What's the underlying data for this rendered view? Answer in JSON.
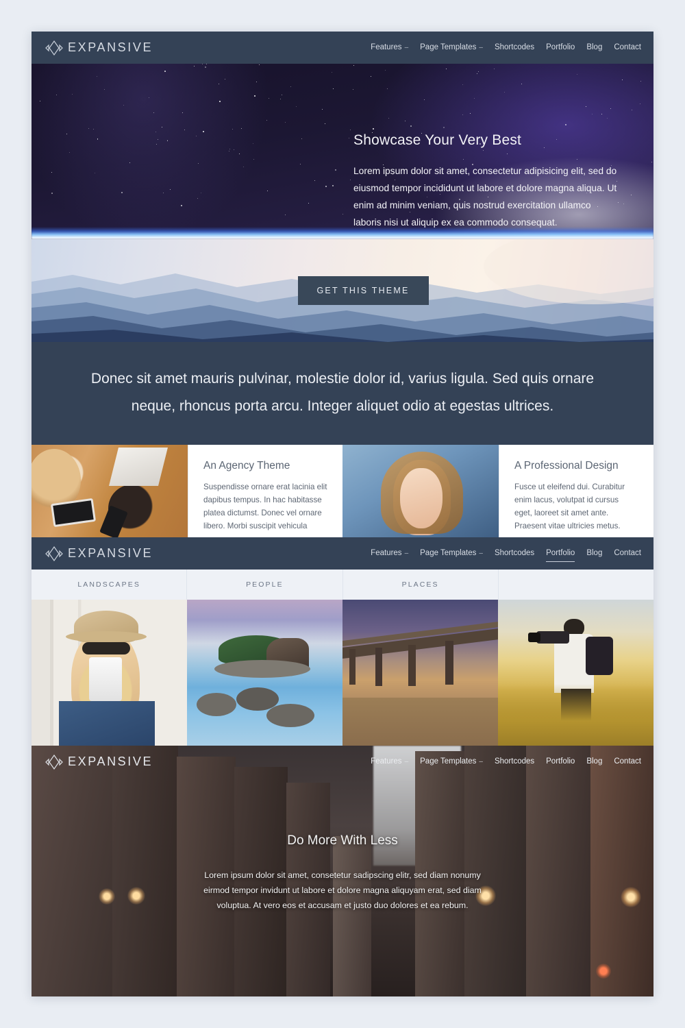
{
  "brand": {
    "name": "EXPANSIVE",
    "logo_icon": "diamond-arrows-icon"
  },
  "nav": {
    "items": [
      {
        "label": "Features",
        "caret": "–",
        "has_dropdown": true,
        "active": false
      },
      {
        "label": "Page Templates",
        "caret": "–",
        "has_dropdown": true,
        "active": false
      },
      {
        "label": "Shortcodes",
        "caret": "",
        "has_dropdown": false,
        "active": false
      },
      {
        "label": "Portfolio",
        "caret": "",
        "has_dropdown": false,
        "active": false
      },
      {
        "label": "Blog",
        "caret": "",
        "has_dropdown": false,
        "active": false
      },
      {
        "label": "Contact",
        "caret": "",
        "has_dropdown": false,
        "active": false
      }
    ],
    "portfolio_active_index": 3
  },
  "hero": {
    "title": "Showcase Your Very Best",
    "paragraph": "Lorem ipsum dolor sit amet, consectetur adipisicing elit, sed do eiusmod tempor incididunt ut labore et dolore magna aliqua. Ut enim ad minim veniam, quis nostrud exercitation ullamco laboris nisi ut aliquip ex ea commodo consequat.",
    "cta_label": "GET THIS THEME",
    "background": "starfield-space-horizon"
  },
  "quote": {
    "text": "Donec sit amet mauris pulvinar, molestie dolor id, varius ligula. Sed quis ornare neque, rhoncus porta arcu. Integer aliquet odio at egestas ultrices."
  },
  "features": [
    {
      "image_name": "team-working-overhead-photo",
      "title": "An Agency Theme",
      "body": "Suspendisse ornare erat lacinia elit dapibus tempus. In hac habitasse platea dictumst. Donec vel ornare libero. Morbi suscipit vehicula"
    },
    {
      "image_name": "smiling-woman-portrait-photo",
      "title": "A Professional Design",
      "body": "Fusce ut eleifend dui. Curabitur enim lacus, volutpat id cursus eget, laoreet sit amet ante. Praesent vitae ultricies metus."
    }
  ],
  "portfolio": {
    "filters": [
      "LANDSCAPES",
      "PEOPLE",
      "PLACES",
      ""
    ],
    "items": [
      {
        "image_name": "woman-with-hat-drinking-coffee"
      },
      {
        "image_name": "rocky-island-in-blue-water"
      },
      {
        "image_name": "beach-pier-at-sunset"
      },
      {
        "image_name": "photographer-in-wheat-field"
      }
    ]
  },
  "city_section": {
    "title": "Do More With Less",
    "paragraph": "Lorem ipsum dolor sit amet, consetetur sadipscing elitr, sed diam nonumy eirmod tempor invidunt ut labore et dolore magna aliquyam erat, sed diam voluptua. At vero eos et accusam et justo duo dolores et ea rebum.",
    "background": "downtown-city-street-at-dusk"
  },
  "colors": {
    "navy": "#344256",
    "page_background": "#e9edf3",
    "text_light": "#d8dde5",
    "body_text": "#5d6673",
    "cta_background": "#394859"
  }
}
